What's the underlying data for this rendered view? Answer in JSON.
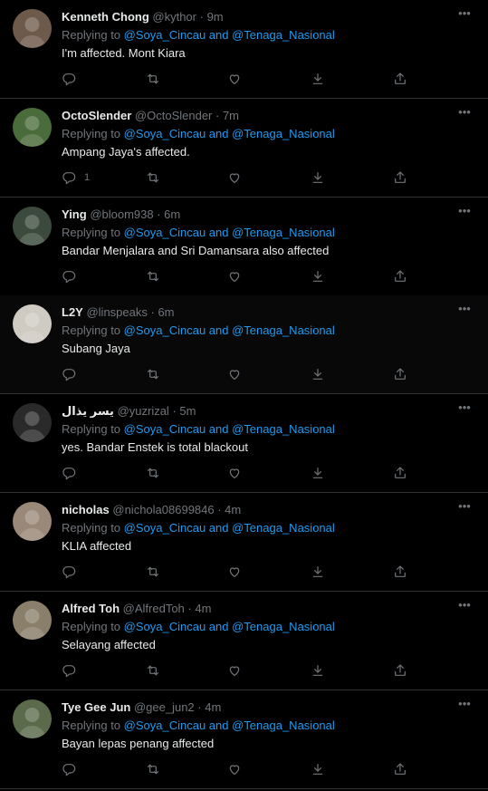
{
  "tweets": [
    {
      "name": "Kenneth Chong",
      "handle": "@kythor",
      "time": "9m",
      "replying_prefix": "Replying to ",
      "mention1": "@Soya_Cincau",
      "and": " and ",
      "mention2": "@Tenaga_Nasional",
      "text": "I'm affected. Mont Kiara",
      "reply_count": "",
      "avatar_color": "#6e5a4a"
    },
    {
      "name": "OctoSlender",
      "handle": "@OctoSlender",
      "time": "7m",
      "replying_prefix": "Replying to ",
      "mention1": "@Soya_Cincau",
      "and": " and ",
      "mention2": "@Tenaga_Nasional",
      "text": "Ampang Jaya's affected.",
      "reply_count": "1",
      "avatar_color": "#4a6b3a"
    },
    {
      "name": "Ying",
      "handle": "@bloom938",
      "time": "6m",
      "replying_prefix": "Replying to ",
      "mention1": "@Soya_Cincau",
      "and": " and ",
      "mention2": "@Tenaga_Nasional",
      "text": "Bandar Menjalara and Sri Damansara also affected",
      "reply_count": "",
      "avatar_color": "#3b4a3c"
    },
    {
      "name": "L2Y",
      "handle": "@linspeaks",
      "time": "6m",
      "replying_prefix": "Replying to ",
      "mention1": "@Soya_Cincau",
      "and": " and ",
      "mention2": "@Tenaga_Nasional",
      "text": "Subang Jaya",
      "reply_count": "",
      "avatar_color": "#cfcac2"
    },
    {
      "name": "يسر يذال",
      "handle": "@yuzrizal",
      "time": "5m",
      "replying_prefix": "Replying to ",
      "mention1": "@Soya_Cincau",
      "and": " and ",
      "mention2": "@Tenaga_Nasional",
      "text": "yes. Bandar Enstek is total blackout",
      "reply_count": "",
      "avatar_color": "#2a2a2a"
    },
    {
      "name": "nicholas",
      "handle": "@nichola08699846",
      "time": "4m",
      "replying_prefix": "Replying to ",
      "mention1": "@Soya_Cincau",
      "and": " and ",
      "mention2": "@Tenaga_Nasional",
      "text": "KLIA affected",
      "reply_count": "",
      "avatar_color": "#9a8878"
    },
    {
      "name": "Alfred Toh",
      "handle": "@AlfredToh",
      "time": "4m",
      "replying_prefix": "Replying to ",
      "mention1": "@Soya_Cincau",
      "and": " and ",
      "mention2": "@Tenaga_Nasional",
      "text": "Selayang affected",
      "reply_count": "",
      "avatar_color": "#8a7f6a"
    },
    {
      "name": "Tye Gee Jun",
      "handle": "@gee_jun2",
      "time": "4m",
      "replying_prefix": "Replying to ",
      "mention1": "@Soya_Cincau",
      "and": " and ",
      "mention2": "@Tenaga_Nasional",
      "text": "Bayan lepas penang affected",
      "reply_count": "",
      "avatar_color": "#5a6a4a"
    }
  ],
  "more_label": "•••",
  "dot_separator": " · ",
  "colors": {
    "background": "#000000",
    "text": "#e7e9ea",
    "muted": "#71767b",
    "accent": "#1d9bf0",
    "divider": "#2f3336"
  }
}
